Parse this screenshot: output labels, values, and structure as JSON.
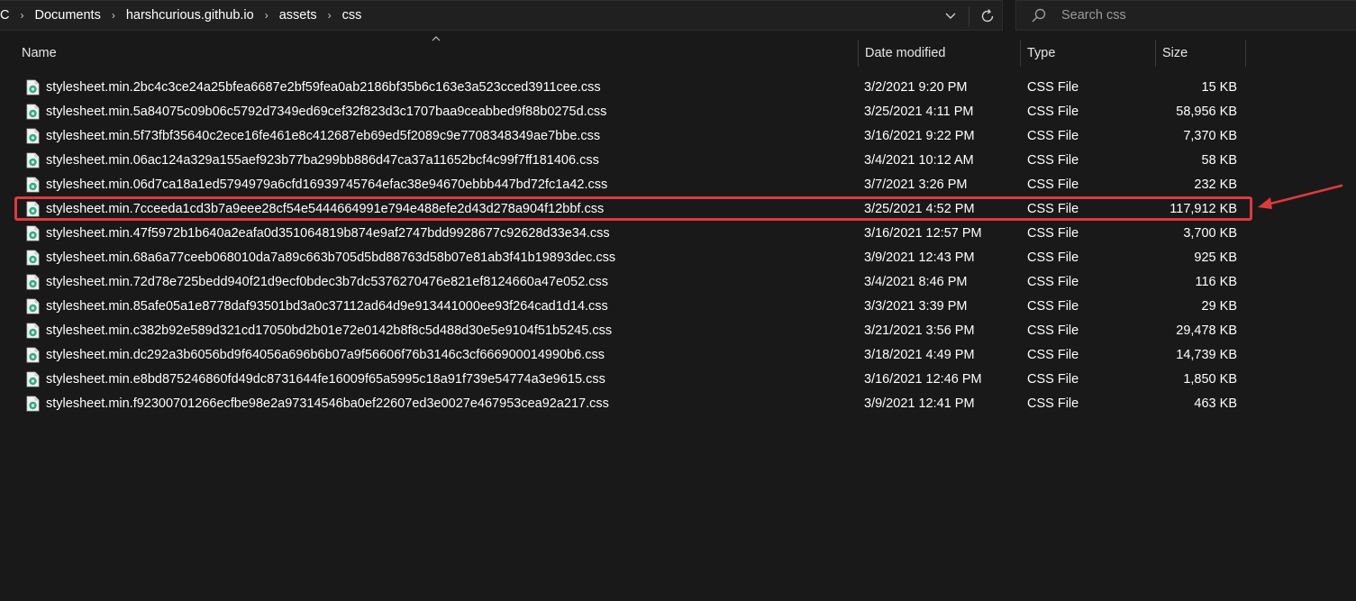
{
  "breadcrumb": {
    "items": [
      "C",
      "Documents",
      "harshcurious.github.io",
      "assets",
      "css"
    ],
    "separator": "›"
  },
  "search": {
    "placeholder": "Search css"
  },
  "columns": {
    "name": "Name",
    "date": "Date modified",
    "type": "Type",
    "size": "Size"
  },
  "files": [
    {
      "name": "stylesheet.min.2bc4c3ce24a25bfea6687e2bf59fea0ab2186bf35b6c163e3a523cced3911cee.css",
      "date": "3/2/2021 9:20 PM",
      "type": "CSS File",
      "size": "15 KB"
    },
    {
      "name": "stylesheet.min.5a84075c09b06c5792d7349ed69cef32f823d3c1707baa9ceabbed9f88b0275d.css",
      "date": "3/25/2021 4:11 PM",
      "type": "CSS File",
      "size": "58,956 KB"
    },
    {
      "name": "stylesheet.min.5f73fbf35640c2ece16fe461e8c412687eb69ed5f2089c9e7708348349ae7bbe.css",
      "date": "3/16/2021 9:22 PM",
      "type": "CSS File",
      "size": "7,370 KB"
    },
    {
      "name": "stylesheet.min.06ac124a329a155aef923b77ba299bb886d47ca37a11652bcf4c99f7ff181406.css",
      "date": "3/4/2021 10:12 AM",
      "type": "CSS File",
      "size": "58 KB"
    },
    {
      "name": "stylesheet.min.06d7ca18a1ed5794979a6cfd16939745764efac38e94670ebbb447bd72fc1a42.css",
      "date": "3/7/2021 3:26 PM",
      "type": "CSS File",
      "size": "232 KB"
    },
    {
      "name": "stylesheet.min.7cceeda1cd3b7a9eee28cf54e5444664991e794e488efe2d43d278a904f12bbf.css",
      "date": "3/25/2021 4:52 PM",
      "type": "CSS File",
      "size": "117,912 KB"
    },
    {
      "name": "stylesheet.min.47f5972b1b640a2eafa0d351064819b874e9af2747bdd9928677c92628d33e34.css",
      "date": "3/16/2021 12:57 PM",
      "type": "CSS File",
      "size": "3,700 KB"
    },
    {
      "name": "stylesheet.min.68a6a77ceeb068010da7a89c663b705d5bd88763d58b07e81ab3f41b19893dec.css",
      "date": "3/9/2021 12:43 PM",
      "type": "CSS File",
      "size": "925 KB"
    },
    {
      "name": "stylesheet.min.72d78e725bedd940f21d9ecf0bdec3b7dc5376270476e821ef8124660a47e052.css",
      "date": "3/4/2021 8:46 PM",
      "type": "CSS File",
      "size": "116 KB"
    },
    {
      "name": "stylesheet.min.85afe05a1e8778daf93501bd3a0c37112ad64d9e913441000ee93f264cad1d14.css",
      "date": "3/3/2021 3:39 PM",
      "type": "CSS File",
      "size": "29 KB"
    },
    {
      "name": "stylesheet.min.c382b92e589d321cd17050bd2b01e72e0142b8f8c5d488d30e5e9104f51b5245.css",
      "date": "3/21/2021 3:56 PM",
      "type": "CSS File",
      "size": "29,478 KB"
    },
    {
      "name": "stylesheet.min.dc292a3b6056bd9f64056a696b6b07a9f56606f76b3146c3cf666900014990b6.css",
      "date": "3/18/2021 4:49 PM",
      "type": "CSS File",
      "size": "14,739 KB"
    },
    {
      "name": "stylesheet.min.e8bd875246860fd49dc8731644fe16009f65a5995c18a91f739e54774a3e9615.css",
      "date": "3/16/2021 12:46 PM",
      "type": "CSS File",
      "size": "1,850 KB"
    },
    {
      "name": "stylesheet.min.f92300701266ecfbe98e2a97314546ba0ef22607ed3e0027e467953cea92a217.css",
      "date": "3/9/2021 12:41 PM",
      "type": "CSS File",
      "size": "463 KB"
    }
  ],
  "annotation": {
    "highlighted_row": 5,
    "color": "#e0393b"
  },
  "icons": {
    "file": "css-file-icon",
    "search": "search-icon",
    "dropdown": "chevron-down-icon",
    "refresh": "refresh-icon",
    "sort": "sort-ascending-icon"
  }
}
